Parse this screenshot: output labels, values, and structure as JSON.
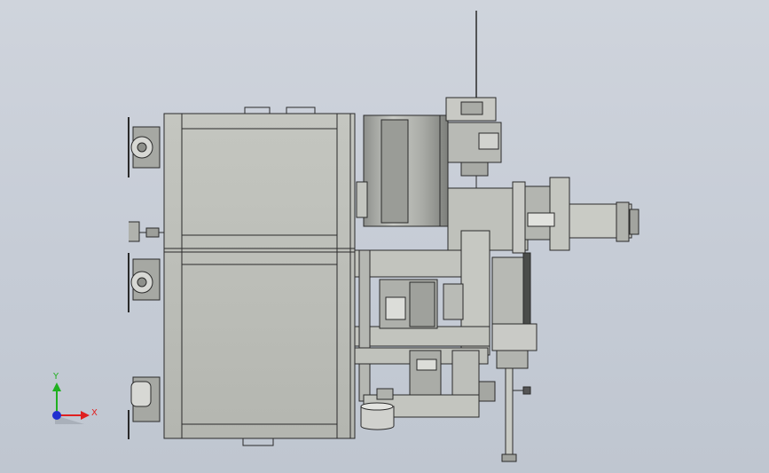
{
  "viewport": {
    "background_color": "#c8ced7",
    "metal_color": "#b9bbb6",
    "edge_color": "#2a2a2a"
  },
  "triad": {
    "x_label": "X",
    "y_label": "Y",
    "x_color": "#e02020",
    "y_color": "#20b020",
    "z_color": "#2030d0"
  }
}
